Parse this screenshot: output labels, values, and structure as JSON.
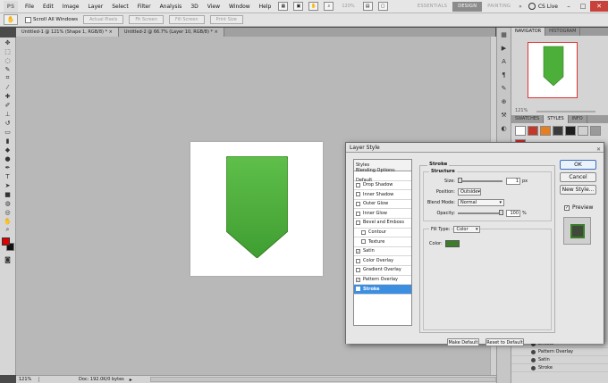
{
  "app": {
    "logo": "PS",
    "menu": [
      "File",
      "Edit",
      "Image",
      "Layer",
      "Select",
      "Filter",
      "Analysis",
      "3D",
      "View",
      "Window",
      "Help"
    ],
    "zoom_readout": "120%",
    "workspaces": [
      "ESSENTIALS",
      "DESIGN",
      "PAINTING"
    ],
    "active_workspace": "DESIGN",
    "more": "»",
    "cs_live": "CS Live",
    "window_buttons": {
      "minimize": "–",
      "maximize": "□",
      "close": "✕"
    }
  },
  "options_bar": {
    "tool_icon": "hand-icon",
    "scroll_all_label": "Scroll All Windows",
    "buttons": [
      "Actual Pixels",
      "Fit Screen",
      "Fill Screen",
      "Print Size"
    ]
  },
  "doc_tabs": [
    {
      "label": "Untitled-1 @ 121% (Shape 1, RGB/8) *",
      "close": "×"
    },
    {
      "label": "Untitled-2 @ 66.7% (Layer 10, RGB/8) *",
      "close": "×"
    }
  ],
  "status": {
    "zoom": "121%",
    "doc_info": "Doc: 192.0K/0 bytes",
    "arrow": "▸"
  },
  "panels": {
    "navigator_tabs": [
      "NAVIGATOR",
      "HISTOGRAM"
    ],
    "navigator_zoom": "121%",
    "styles_tabs": [
      "SWATCHES",
      "STYLES",
      "INFO"
    ],
    "style_swatch_colors": [
      "#ffffff",
      "#c0392b",
      "#e67e22",
      "#3b3b3b",
      "#1e1e1e",
      "#d0d0d0",
      "#9a9a9a",
      "#cc2222"
    ],
    "layer_rows": [
      "Effects",
      "Pattern Overlay",
      "Satin",
      "Stroke"
    ]
  },
  "canvas": {
    "ribbon_color": "#4caf3a"
  },
  "dialog": {
    "title": "Layer Style",
    "close_glyph": "✕",
    "list_header": "Styles",
    "blending_label": "Blending Options: Default",
    "items": [
      {
        "label": "Drop Shadow",
        "checked": false,
        "indent": false
      },
      {
        "label": "Inner Shadow",
        "checked": false,
        "indent": false
      },
      {
        "label": "Outer Glow",
        "checked": false,
        "indent": false
      },
      {
        "label": "Inner Glow",
        "checked": false,
        "indent": false
      },
      {
        "label": "Bevel and Emboss",
        "checked": false,
        "indent": false
      },
      {
        "label": "Contour",
        "checked": false,
        "indent": true
      },
      {
        "label": "Texture",
        "checked": false,
        "indent": true
      },
      {
        "label": "Satin",
        "checked": true,
        "indent": false
      },
      {
        "label": "Color Overlay",
        "checked": false,
        "indent": false
      },
      {
        "label": "Gradient Overlay",
        "checked": false,
        "indent": false
      },
      {
        "label": "Pattern Overlay",
        "checked": true,
        "indent": false
      },
      {
        "label": "Stroke",
        "checked": true,
        "indent": false,
        "selected": true
      }
    ],
    "stroke": {
      "title": "Stroke",
      "structure_title": "Structure",
      "size_label": "Size:",
      "size_value": "1",
      "size_unit": "px",
      "position_label": "Position:",
      "position_value": "Outside",
      "blend_label": "Blend Mode:",
      "blend_value": "Normal",
      "opacity_label": "Opacity:",
      "opacity_value": "100",
      "opacity_unit": "%",
      "fill_type_label": "Fill Type:",
      "fill_type_value": "Color",
      "color_label": "Color:",
      "stroke_color": "#3b7d29",
      "make_default": "Make Default",
      "reset_default": "Reset to Default"
    },
    "buttons": {
      "ok": "OK",
      "cancel": "Cancel",
      "new_style": "New Style...",
      "preview": "Preview"
    }
  }
}
